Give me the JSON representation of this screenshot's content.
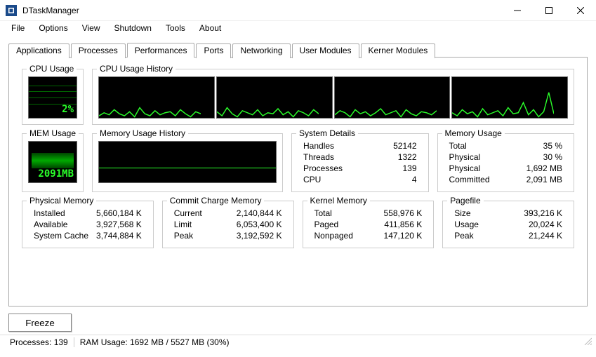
{
  "window": {
    "title": "DTaskManager"
  },
  "menu": {
    "file": "File",
    "options": "Options",
    "view": "View",
    "shutdown": "Shutdown",
    "tools": "Tools",
    "about": "About"
  },
  "tabs": {
    "applications": "Applications",
    "processes": "Processes",
    "performances": "Performances",
    "ports": "Ports",
    "networking": "Networking",
    "user_modules": "User Modules",
    "kerner_modules": "Kerner Modules"
  },
  "groups": {
    "cpu_usage": "CPU Usage",
    "cpu_history": "CPU Usage History",
    "mem_usage": "MEM Usage",
    "mem_history": "Memory Usage History",
    "system_details": "System Details",
    "memory_usage": "Memory Usage",
    "physical_memory": "Physical Memory",
    "commit_charge": "Commit Charge Memory",
    "kernel_memory": "Kernel Memory",
    "pagefile": "Pagefile"
  },
  "gauges": {
    "cpu_pct": "2%",
    "mem_mb": "2091MB"
  },
  "system_details": {
    "handles_k": "Handles",
    "handles_v": "52142",
    "threads_k": "Threads",
    "threads_v": "1322",
    "processes_k": "Processes",
    "processes_v": "139",
    "cpu_k": "CPU",
    "cpu_v": "4"
  },
  "memory_usage": {
    "total_k": "Total",
    "total_v": "35 %",
    "physical_pct_k": "Physical",
    "physical_pct_v": "30 %",
    "physical_mb_k": "Physical",
    "physical_mb_v": "1,692 MB",
    "committed_k": "Committed",
    "committed_v": "2,091 MB"
  },
  "physical_memory": {
    "installed_k": "Installed",
    "installed_v": "5,660,184 K",
    "available_k": "Available",
    "available_v": "3,927,568 K",
    "syscache_k": "System Cache",
    "syscache_v": "3,744,884 K"
  },
  "commit_charge": {
    "current_k": "Current",
    "current_v": "2,140,844 K",
    "limit_k": "Limit",
    "limit_v": "6,053,400 K",
    "peak_k": "Peak",
    "peak_v": "3,192,592 K"
  },
  "kernel_memory": {
    "total_k": "Total",
    "total_v": "558,976 K",
    "paged_k": "Paged",
    "paged_v": "411,856 K",
    "nonpaged_k": "Nonpaged",
    "nonpaged_v": "147,120 K"
  },
  "pagefile": {
    "size_k": "Size",
    "size_v": "393,216 K",
    "usage_k": "Usage",
    "usage_v": "20,024 K",
    "peak_k": "Peak",
    "peak_v": "21,244 K"
  },
  "buttons": {
    "freeze": "Freeze"
  },
  "status": {
    "processes": "Processes: 139",
    "ram": "RAM Usage:  1692 MB / 5527 MB (30%)"
  },
  "chart_data": {
    "cpu_usage_pct": 2,
    "mem_usage_mb": 2091,
    "mem_history_pct_approx": 37,
    "cpu_history_series_pct_approx": [
      [
        5,
        8,
        3,
        12,
        6,
        4,
        9,
        2,
        15,
        5,
        3,
        10,
        4,
        6,
        8,
        3,
        11,
        5,
        2,
        7,
        9,
        4,
        12,
        3,
        6,
        8,
        2,
        10,
        5,
        4
      ],
      [
        8,
        3,
        14,
        5,
        2,
        9,
        6,
        4,
        11,
        3,
        7,
        5,
        12,
        4,
        8,
        2,
        10,
        6,
        3,
        9,
        5,
        7,
        4,
        13,
        2,
        8,
        6,
        3,
        10,
        5
      ],
      [
        4,
        9,
        6,
        2,
        11,
        5,
        8,
        3,
        7,
        12,
        4,
        6,
        9,
        2,
        10,
        5,
        3,
        8,
        6,
        4,
        11,
        7,
        2,
        9,
        5,
        3,
        12,
        6,
        4,
        8
      ],
      [
        6,
        3,
        10,
        5,
        8,
        2,
        12,
        4,
        7,
        9,
        3,
        11,
        5,
        6,
        8,
        20,
        4,
        10,
        2,
        7,
        9,
        5,
        3,
        13,
        6,
        4,
        8,
        2,
        30,
        5
      ]
    ]
  }
}
